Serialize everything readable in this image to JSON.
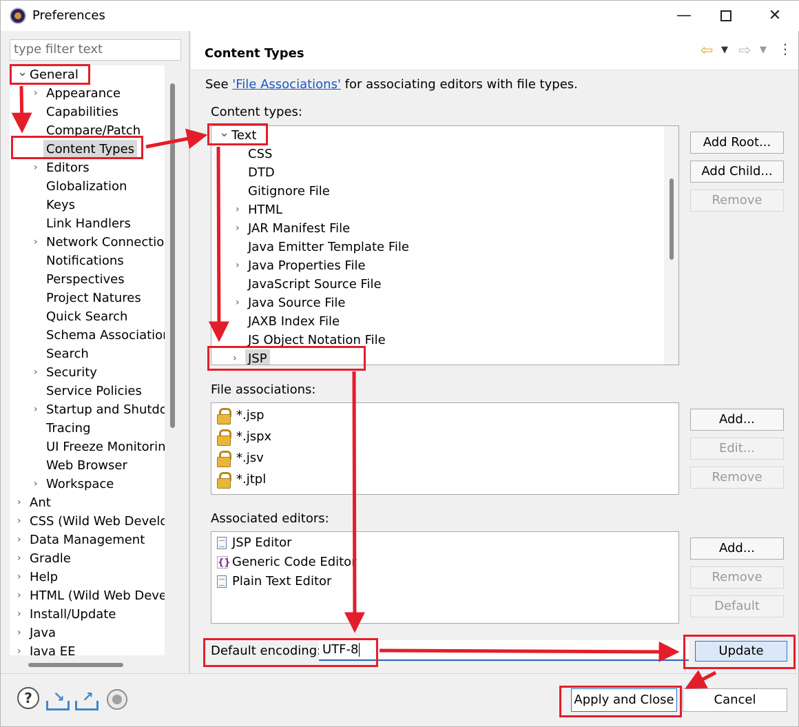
{
  "window": {
    "title": "Preferences",
    "controls": {
      "minimize": "—",
      "maximize": "",
      "close": "✕"
    }
  },
  "filter": {
    "placeholder": "type filter text"
  },
  "tree": {
    "items": [
      {
        "label": "General",
        "level": 0,
        "expanded": true
      },
      {
        "label": "Appearance",
        "level": 1,
        "expandable": true
      },
      {
        "label": "Capabilities",
        "level": 1
      },
      {
        "label": "Compare/Patch",
        "level": 1
      },
      {
        "label": "Content Types",
        "level": 1,
        "selected": true
      },
      {
        "label": "Editors",
        "level": 1,
        "expandable": true
      },
      {
        "label": "Globalization",
        "level": 1
      },
      {
        "label": "Keys",
        "level": 1
      },
      {
        "label": "Link Handlers",
        "level": 1
      },
      {
        "label": "Network Connection",
        "level": 1,
        "expandable": true
      },
      {
        "label": "Notifications",
        "level": 1
      },
      {
        "label": "Perspectives",
        "level": 1
      },
      {
        "label": "Project Natures",
        "level": 1
      },
      {
        "label": "Quick Search",
        "level": 1
      },
      {
        "label": "Schema Associations",
        "level": 1
      },
      {
        "label": "Search",
        "level": 1
      },
      {
        "label": "Security",
        "level": 1,
        "expandable": true
      },
      {
        "label": "Service Policies",
        "level": 1
      },
      {
        "label": "Startup and Shutdown",
        "level": 1,
        "expandable": true
      },
      {
        "label": "Tracing",
        "level": 1
      },
      {
        "label": "UI Freeze Monitoring",
        "level": 1
      },
      {
        "label": "Web Browser",
        "level": 1
      },
      {
        "label": "Workspace",
        "level": 1,
        "expandable": true
      },
      {
        "label": "Ant",
        "level": 0,
        "expandable": true
      },
      {
        "label": "CSS (Wild Web Developer)",
        "level": 0,
        "expandable": true
      },
      {
        "label": "Data Management",
        "level": 0,
        "expandable": true
      },
      {
        "label": "Gradle",
        "level": 0,
        "expandable": true
      },
      {
        "label": "Help",
        "level": 0,
        "expandable": true
      },
      {
        "label": "HTML (Wild Web Developer)",
        "level": 0,
        "expandable": true
      },
      {
        "label": "Install/Update",
        "level": 0,
        "expandable": true
      },
      {
        "label": "Java",
        "level": 0,
        "expandable": true
      },
      {
        "label": "Java EE",
        "level": 0,
        "expandable": true
      }
    ]
  },
  "page": {
    "title": "Content Types",
    "nav": {
      "back": "⇦",
      "dropdown": "▼",
      "forward": "⇨",
      "menu": "⋮"
    },
    "description": {
      "prefix": "See ",
      "link": "'File Associations'",
      "suffix": " for associating editors with file types."
    },
    "content_types_label": "Content types:",
    "content_types": [
      {
        "label": "Text",
        "expanded": true,
        "level": 0
      },
      {
        "label": "CSS",
        "level": 1
      },
      {
        "label": "DTD",
        "level": 1
      },
      {
        "label": "Gitignore File",
        "level": 1
      },
      {
        "label": "HTML",
        "level": 1,
        "expandable": true
      },
      {
        "label": "JAR Manifest File",
        "level": 1,
        "expandable": true
      },
      {
        "label": "Java Emitter Template File",
        "level": 1
      },
      {
        "label": "Java Properties File",
        "level": 1,
        "expandable": true
      },
      {
        "label": "JavaScript Source File",
        "level": 1
      },
      {
        "label": "Java Source File",
        "level": 1,
        "expandable": true
      },
      {
        "label": "JAXB Index File",
        "level": 1
      },
      {
        "label": "JS Object Notation File",
        "level": 1
      },
      {
        "label": "JSP",
        "level": 1,
        "expandable": true,
        "selected": true
      }
    ],
    "content_type_buttons": {
      "add_root": "Add Root...",
      "add_child": "Add Child...",
      "remove": "Remove"
    },
    "file_associations_label": "File associations:",
    "file_associations": [
      "*.jsp",
      "*.jspx",
      "*.jsv",
      "*.jtpl"
    ],
    "file_buttons": {
      "add": "Add...",
      "edit": "Edit...",
      "remove": "Remove"
    },
    "associated_editors_label": "Associated editors:",
    "associated_editors": [
      {
        "label": "JSP Editor",
        "icon": "jsp-file-icon"
      },
      {
        "label": "Generic Code Editor",
        "icon": "code-braces-icon"
      },
      {
        "label": "Plain Text Editor",
        "icon": "text-file-icon"
      }
    ],
    "editor_buttons": {
      "add": "Add...",
      "remove": "Remove",
      "default": "Default"
    },
    "default_encoding_label": "Default encoding:",
    "default_encoding_value": "UTF-8",
    "update_button": "Update"
  },
  "footer": {
    "help_icon": "?",
    "apply_close": "Apply and Close",
    "cancel": "Cancel"
  },
  "annotation_color": "#e41d2a"
}
